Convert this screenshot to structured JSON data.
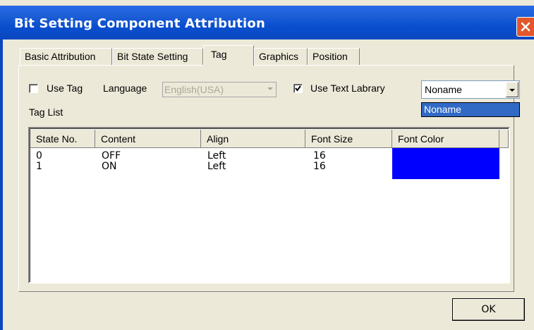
{
  "window": {
    "title": "Bit Setting Component Attribution"
  },
  "tabs": [
    {
      "label": "Basic Attribution"
    },
    {
      "label": "Bit State Setting"
    },
    {
      "label": "Tag"
    },
    {
      "label": "Graphics"
    },
    {
      "label": "Position"
    }
  ],
  "active_tab": "Tag",
  "options": {
    "use_tag_label": "Use Tag",
    "use_tag_checked": false,
    "language_label": "Language",
    "language_value": "English(USA)",
    "use_text_library_label": "Use Text Labrary",
    "use_text_library_checked": true,
    "text_library_value": "Noname",
    "text_library_options": [
      "Noname"
    ]
  },
  "tag_list": {
    "label": "Tag List",
    "columns": [
      "State No.",
      "Content",
      "Align",
      "Font Size",
      "Font Color"
    ],
    "rows": [
      {
        "state": "0",
        "content": "OFF",
        "align": "Left",
        "font_size": "16",
        "font_color": "#0000ff"
      },
      {
        "state": "1",
        "content": "ON",
        "align": "Left",
        "font_size": "16",
        "font_color": "#0000ff"
      }
    ]
  },
  "buttons": {
    "ok_label": "OK"
  },
  "colors": {
    "title_bar": "#0a4fcf",
    "close_button": "#e2572b",
    "selection": "#316ac5"
  },
  "icons": {
    "close": "close-icon",
    "dropdown": "chevron-down-icon",
    "check": "check-icon"
  }
}
